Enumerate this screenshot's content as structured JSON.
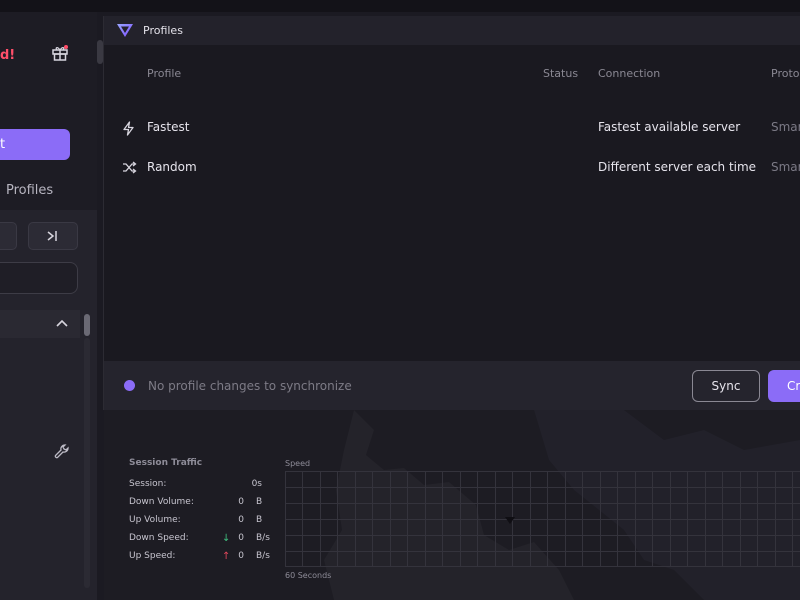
{
  "sidebar": {
    "alert_text": "d!",
    "primary_button_label": "t",
    "profiles_tab_label": "Profiles"
  },
  "dialog": {
    "title": "Profiles",
    "columns": {
      "profile": "Profile",
      "status": "Status",
      "connection": "Connection",
      "protocol": "Protoc"
    },
    "rows": [
      {
        "icon": "lightning-icon",
        "name": "Fastest",
        "connection": "Fastest available server",
        "protocol": "Smar"
      },
      {
        "icon": "shuffle-icon",
        "name": "Random",
        "connection": "Different server each time",
        "protocol": "Smar"
      }
    ],
    "footer": {
      "status_text": "No profile changes to synchronize",
      "sync_label": "Sync",
      "create_label": "Cr"
    }
  },
  "traffic": {
    "title": "Session Traffic",
    "session_label": "Session:",
    "session_value": "0s",
    "down_volume_label": "Down Volume:",
    "down_volume_value": "0",
    "down_volume_unit": "B",
    "up_volume_label": "Up Volume:",
    "up_volume_value": "0",
    "up_volume_unit": "B",
    "down_speed_label": "Down Speed:",
    "down_speed_value": "0",
    "down_speed_unit": "B/s",
    "up_speed_label": "Up Speed:",
    "up_speed_value": "0",
    "up_speed_unit": "B/s",
    "speed_label": "Speed",
    "speed_footer": "60 Seconds"
  },
  "colors": {
    "accent": "#8b6cf7",
    "alert": "#ff4f6a",
    "down_arrow": "#3fbf7f",
    "up_arrow": "#e0475b"
  }
}
